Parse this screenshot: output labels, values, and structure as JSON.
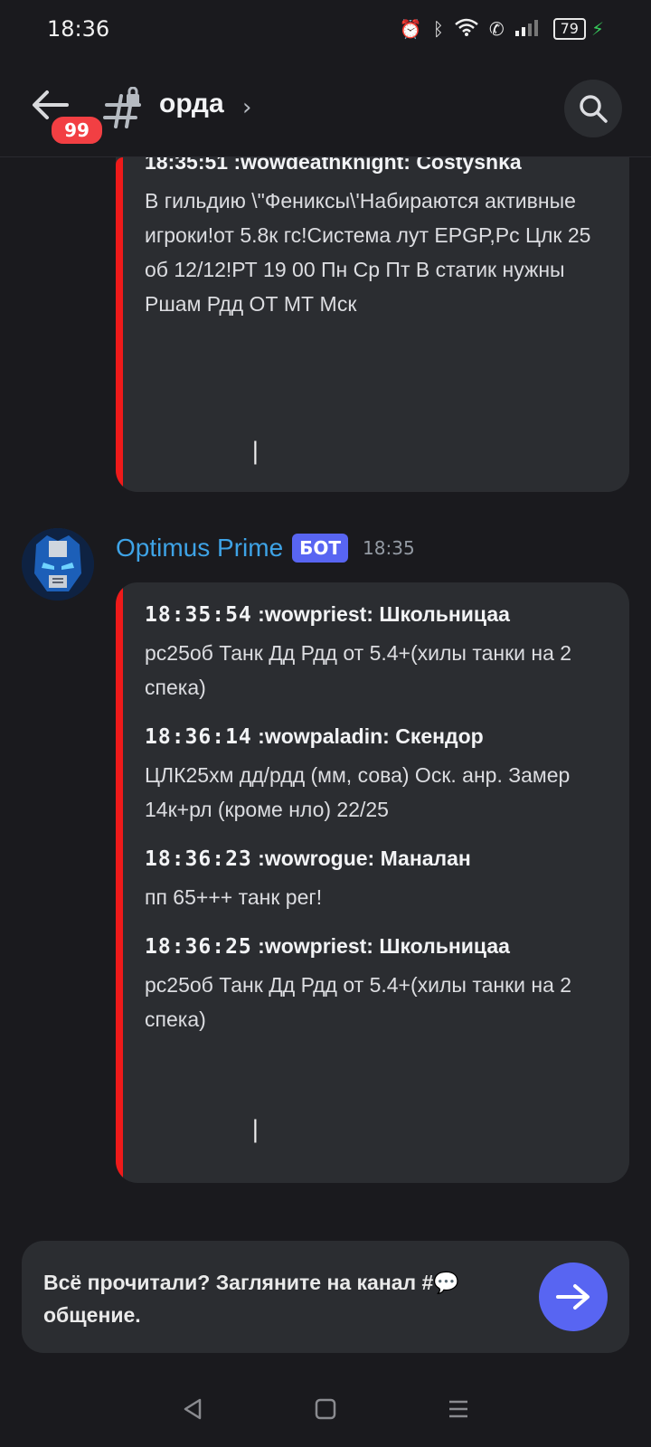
{
  "status": {
    "time": "18:36",
    "battery": "79"
  },
  "header": {
    "badge": "99",
    "channel": "орда"
  },
  "messages_top": {
    "header": "18:35:51 :wowdeathknight: Costyshka",
    "body": "В гильдию \\\"Фениксы\\'Набираются активные игроки!от 5.8к гс!Система лут EPGP,Рс Цлк 25 об 12/12!РТ 19 00 Пн Ср Пт В статик нужны Ршам Рдд ОТ МТ Мск"
  },
  "author": {
    "name": "Optimus Prime",
    "tag": "БОТ",
    "time": "18:35"
  },
  "messages": [
    {
      "ts": "18:35:54",
      "user": ":wowpriest: Школьницаа",
      "body": "рс25об Танк Дд Рдд от 5.4+(хилы танки на 2 спека)"
    },
    {
      "ts": "18:36:14",
      "user": ":wowpaladin: Скендор",
      "body": "ЦЛК25хм дд/рдд (мм, сова) Оск. анр. Замер 14к+рл (кроме нло) 22/25"
    },
    {
      "ts": "18:36:23",
      "user": ":wowrogue: Маналан",
      "body": "пп 65+++ танк рег!"
    },
    {
      "ts": "18:36:25",
      "user": ":wowpriest: Школьницаа",
      "body": "рс25об Танк Дд Рдд от 5.4+(хилы танки на 2 спека)"
    }
  ],
  "cursor": "|",
  "banner": {
    "text": "Всё прочитали? Загляните на канал #💬общение."
  },
  "icons": {
    "back": "arrow-left-icon",
    "channel": "locked-channel-hash-icon",
    "search": "search-icon",
    "go": "arrow-right-icon",
    "nav_back": "triangle-back-icon",
    "nav_home": "square-home-icon",
    "nav_menu": "menu-lines-icon"
  },
  "colors": {
    "accent": "#5865f2",
    "embed_bar": "#ee1a1a",
    "author": "#3ea3e6",
    "badge": "#f23f43"
  }
}
